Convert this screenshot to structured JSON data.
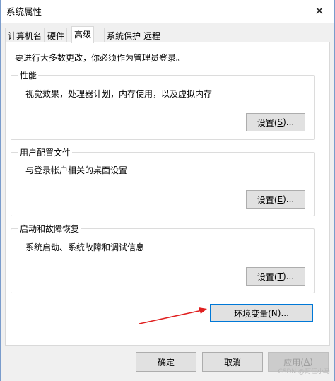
{
  "window": {
    "title": "系统属性",
    "close_glyph": "✕"
  },
  "tabs": [
    {
      "label": "计算机名"
    },
    {
      "label": "硬件"
    },
    {
      "label": "高级"
    },
    {
      "label": "系统保护"
    },
    {
      "label": "远程"
    }
  ],
  "admin_note": "要进行大多数更改，你必须作为管理员登录。",
  "groups": {
    "performance": {
      "title": "性能",
      "desc": "视觉效果，处理器计划，内存使用，以及虚拟内存",
      "button_label": "设置(",
      "button_key": "S",
      "button_tail": ")..."
    },
    "profile": {
      "title": "用户配置文件",
      "desc": "与登录帐户相关的桌面设置",
      "button_label": "设置(",
      "button_key": "E",
      "button_tail": ")..."
    },
    "startup": {
      "title": "启动和故障恢复",
      "desc": "系统启动、系统故障和调试信息",
      "button_label": "设置(",
      "button_key": "T",
      "button_tail": ")..."
    }
  },
  "env_button": {
    "label": "环境变量(",
    "key": "N",
    "tail": ")..."
  },
  "footer": {
    "ok": "确定",
    "cancel": "取消",
    "apply_label": "应用(",
    "apply_key": "A",
    "apply_tail": ")"
  },
  "watermark": "CSDN @阿佳小马",
  "colors": {
    "arrow": "#e02020",
    "focus": "#0078d7"
  }
}
